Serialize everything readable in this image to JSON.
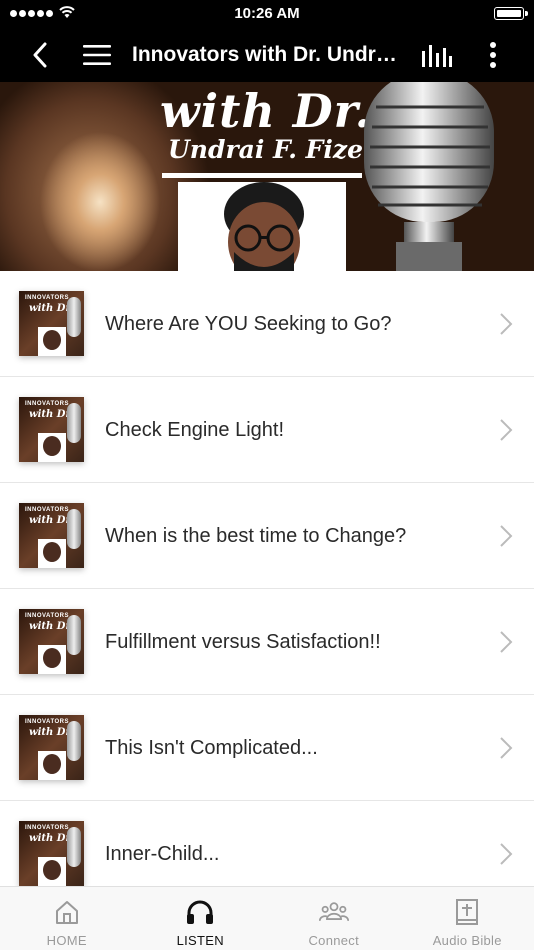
{
  "status_bar": {
    "time": "10:26 AM",
    "signal_icon": "signal-dots-icon",
    "wifi_icon": "wifi-icon",
    "battery_icon": "battery-full-icon"
  },
  "nav": {
    "title": "Innovators with Dr. Undrai F. Fizer",
    "back_icon": "chevron-left-icon",
    "menu_icon": "hamburger-menu-icon",
    "equalizer_icon": "equalizer-bars-icon",
    "more_icon": "vertical-dots-icon"
  },
  "banner": {
    "line1": "with Dr.",
    "line2": "Undrai F. Fizer"
  },
  "thumbnail": {
    "line1": "INNOVATORS",
    "line2": "with Dr."
  },
  "episodes": [
    {
      "title": "Where Are YOU Seeking to Go?"
    },
    {
      "title": "Check Engine Light!"
    },
    {
      "title": "When is the best time to Change?"
    },
    {
      "title": "Fulfillment versus Satisfaction!!"
    },
    {
      "title": "This Isn't Complicated..."
    },
    {
      "title": "Inner-Child..."
    }
  ],
  "tabs": [
    {
      "label": "HOME",
      "icon": "home-icon",
      "active": false
    },
    {
      "label": "LISTEN",
      "icon": "headphones-icon",
      "active": true
    },
    {
      "label": "Connect",
      "icon": "group-icon",
      "active": false
    },
    {
      "label": "Audio Bible",
      "icon": "bible-icon",
      "active": false
    }
  ],
  "colors": {
    "nav_background": "#000000",
    "tab_active": "#111111",
    "tab_inactive": "#9a9a9a",
    "chevron": "#bbbbbb"
  }
}
